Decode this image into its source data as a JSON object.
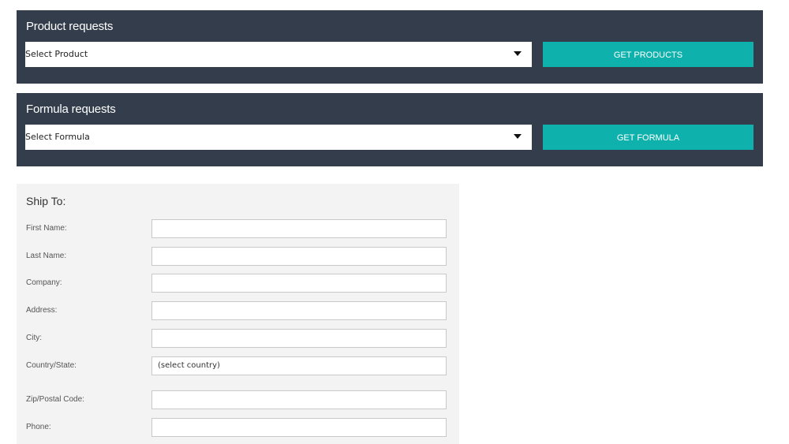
{
  "product_requests": {
    "title": "Product requests",
    "select_value": "Select Product",
    "button_label": "GET PRODUCTS"
  },
  "formula_requests": {
    "title": "Formula requests",
    "select_value": "Select Formula",
    "button_label": "GET FORMULA"
  },
  "ship_to": {
    "title": "Ship To:",
    "fields": [
      {
        "label": "First Name:",
        "value": ""
      },
      {
        "label": "Last Name:",
        "value": ""
      },
      {
        "label": "Company:",
        "value": ""
      },
      {
        "label": "Address:",
        "value": ""
      },
      {
        "label": "City:",
        "value": ""
      },
      {
        "label": "Country/State:",
        "value": "(select country)"
      },
      {
        "label": "Zip/Postal Code:",
        "value": ""
      },
      {
        "label": "Phone:",
        "value": ""
      }
    ]
  },
  "colors": {
    "panel_bg": "#333d4b",
    "accent": "#0fb1ac",
    "form_bg": "#f3f3f3"
  },
  "icons": {
    "dropdown": "caret-down-icon"
  }
}
